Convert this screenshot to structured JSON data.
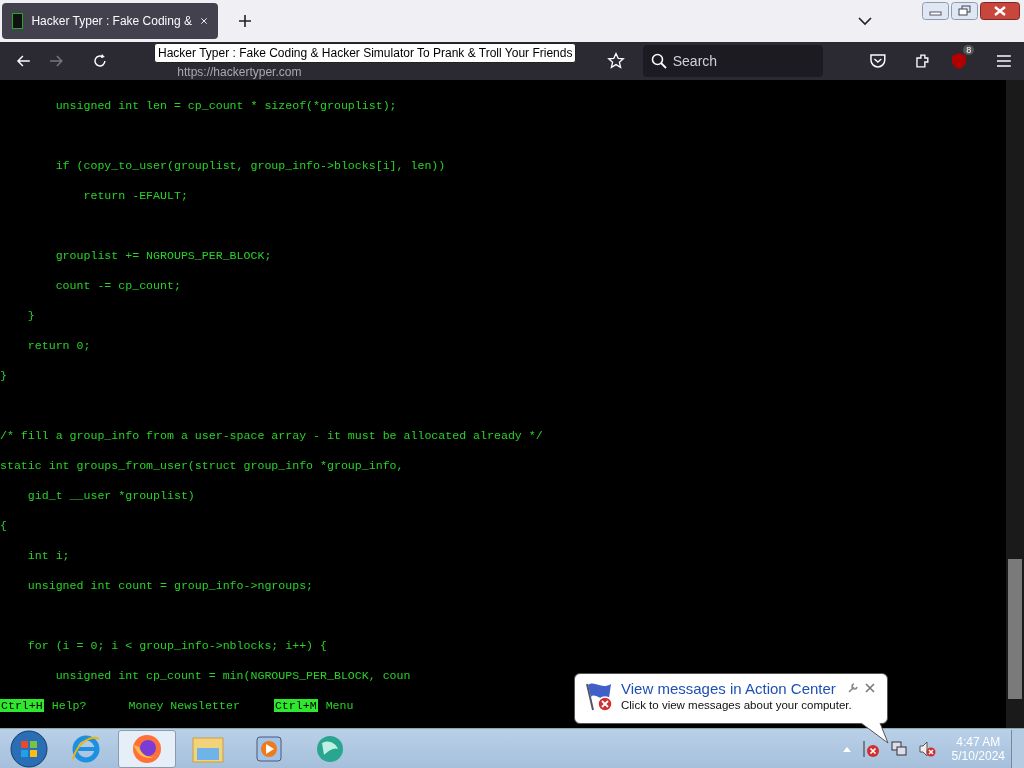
{
  "browser": {
    "tab": {
      "title": "Hacker Typer : Fake Coding &",
      "selected": true
    },
    "tooltip": "Hacker Typer : Fake Coding & Hacker Simulator To Prank & Troll Your Friends",
    "url": "https://hackertyper.com",
    "search": {
      "placeholder": "Search"
    },
    "extension_badge": "8"
  },
  "code_blocks": [
    [
      "        unsigned int len = cp_count * sizeof(*grouplist);"
    ],
    [
      "        if (copy_to_user(grouplist, group_info->blocks[i], len))",
      "            return -EFAULT;"
    ],
    [
      "        grouplist += NGROUPS_PER_BLOCK;",
      "        count -= cp_count;",
      "    }",
      "    return 0;",
      "}"
    ],
    [
      "/* fill a group_info from a user-space array - it must be allocated already */",
      "static int groups_from_user(struct group_info *group_info,",
      "    gid_t __user *grouplist)",
      "{",
      "    int i;",
      "    unsigned int count = group_info->ngroups;"
    ],
    [
      "    for (i = 0; i < group_info->nblocks; i++) {",
      "        unsigned int cp_count = min(NGROUPS_PER_BLOCK, coun"
    ]
  ],
  "footer": [
    {
      "kind": "key",
      "text": "Ctrl+H"
    },
    {
      "kind": "link",
      "text": "Help?"
    },
    {
      "kind": "link",
      "text": "Money Newsletter"
    },
    {
      "kind": "key",
      "text": "Ctrl+M"
    },
    {
      "kind": "link",
      "text": "Menu"
    }
  ],
  "notification": {
    "title": "View messages in Action Center",
    "message": "Click to view messages about your computer."
  },
  "taskbar": {
    "apps": [
      {
        "kind": "ie",
        "selected": false
      },
      {
        "kind": "firefox",
        "selected": true
      },
      {
        "kind": "folder",
        "selected": false
      },
      {
        "kind": "media",
        "selected": false
      },
      {
        "kind": "globe",
        "selected": false
      }
    ],
    "time": "4:47 AM",
    "date": "5/10/2024"
  }
}
